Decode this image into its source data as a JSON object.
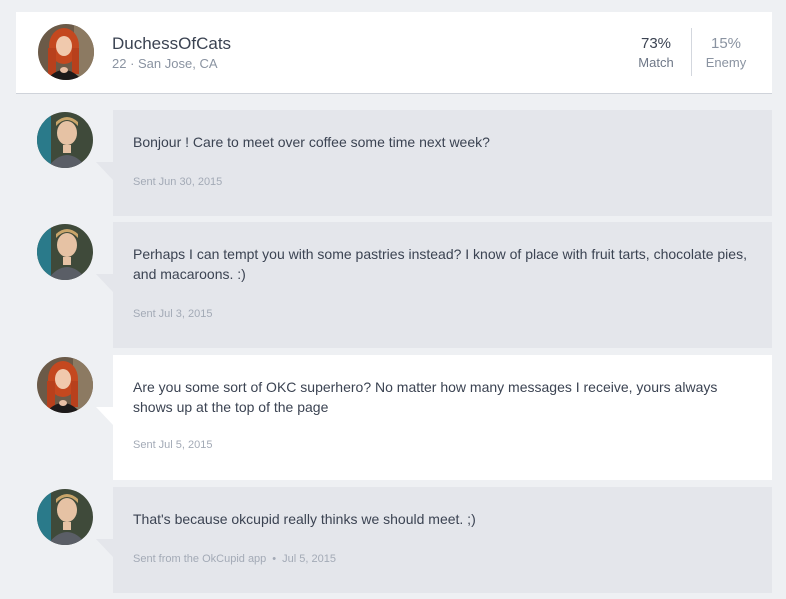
{
  "profile": {
    "name": "DuchessOfCats",
    "meta": "22 · San Jose, CA",
    "match_pct": "73%",
    "match_label": "Match",
    "enemy_pct": "15%",
    "enemy_label": "Enemy"
  },
  "messages": [
    {
      "text": "Bonjour ! Care to meet over coffee some time next week?",
      "sent": "Sent Jun 30, 2015",
      "from": "me"
    },
    {
      "text": "Perhaps I can tempt you with some pastries instead? I know of place with fruit tarts, chocolate pies, and macaroons. :)",
      "sent": "Sent Jul 3, 2015",
      "from": "me"
    },
    {
      "text": "Are you some sort of OKC superhero? No matter how many messages I receive, yours always shows up at the top of the page",
      "sent": "Sent Jul 5, 2015",
      "from": "them"
    },
    {
      "text": "That's because okcupid really thinks we should meet. ;)",
      "sent": "Sent from the OkCupid app",
      "sent_date": "Jul 5, 2015",
      "from": "me"
    }
  ],
  "colors": {
    "background": "#eef0f3",
    "my_bubble": "#e4e6eb",
    "their_bubble": "#ffffff",
    "text": "#3b4352",
    "muted": "#a3aab6"
  }
}
